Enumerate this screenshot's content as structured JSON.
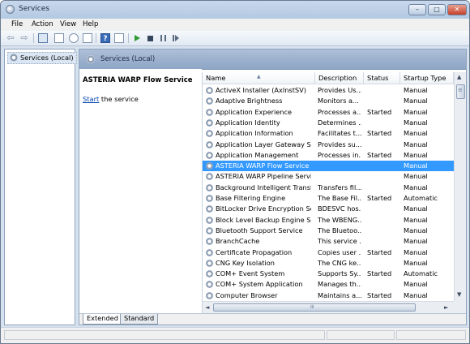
{
  "window": {
    "title": "Services",
    "app_icon": "services-gear-icon"
  },
  "window_controls": {
    "minimize": "–",
    "maximize": "□",
    "close": "✕"
  },
  "menu": [
    "File",
    "Action",
    "View",
    "Help"
  ],
  "toolbar": {
    "icons": [
      "back-arrow-icon",
      "forward-arrow-icon",
      "show-hide-console-tree-icon",
      "properties-icon",
      "refresh-icon",
      "export-list-icon",
      "help-icon",
      "show-hide-action-pane-icon",
      "start-service-icon",
      "stop-service-icon",
      "pause-service-icon",
      "restart-service-icon"
    ],
    "help_glyph": "?"
  },
  "tree": {
    "item": "Services (Local)"
  },
  "pane_header": "Services (Local)",
  "details": {
    "selected_service": "ASTERIA WARP Flow Service",
    "link_text": "Start",
    "link_suffix": " the service"
  },
  "columns": [
    "Name",
    "Description",
    "Status",
    "Startup Type"
  ],
  "rows": [
    {
      "name": "ActiveX Installer (AxInstSV)",
      "description": "Provides Us...",
      "status": "",
      "startup": "Manual"
    },
    {
      "name": "Adaptive Brightness",
      "description": "Monitors a...",
      "status": "",
      "startup": "Manual"
    },
    {
      "name": "Application Experience",
      "description": "Processes a...",
      "status": "Started",
      "startup": "Manual"
    },
    {
      "name": "Application Identity",
      "description": "Determines ...",
      "status": "",
      "startup": "Manual"
    },
    {
      "name": "Application Information",
      "description": "Facilitates t...",
      "status": "Started",
      "startup": "Manual"
    },
    {
      "name": "Application Layer Gateway Ser...",
      "description": "Provides su...",
      "status": "",
      "startup": "Manual"
    },
    {
      "name": "Application Management",
      "description": "Processes in...",
      "status": "Started",
      "startup": "Manual"
    },
    {
      "name": "ASTERIA WARP Flow Service",
      "description": "",
      "status": "",
      "startup": "Manual",
      "selected": true
    },
    {
      "name": "ASTERIA WARP Pipeline Service",
      "description": "",
      "status": "",
      "startup": "Manual"
    },
    {
      "name": "Background Intelligent Transfe...",
      "description": "Transfers fil...",
      "status": "",
      "startup": "Manual"
    },
    {
      "name": "Base Filtering Engine",
      "description": "The Base Fil...",
      "status": "Started",
      "startup": "Automatic"
    },
    {
      "name": "BitLocker Drive Encryption Ser...",
      "description": "BDESVC hos...",
      "status": "",
      "startup": "Manual"
    },
    {
      "name": "Block Level Backup Engine Ser...",
      "description": "The WBENG...",
      "status": "",
      "startup": "Manual"
    },
    {
      "name": "Bluetooth Support Service",
      "description": "The Bluetoo...",
      "status": "",
      "startup": "Manual"
    },
    {
      "name": "BranchCache",
      "description": "This service ...",
      "status": "",
      "startup": "Manual"
    },
    {
      "name": "Certificate Propagation",
      "description": "Copies user ...",
      "status": "Started",
      "startup": "Manual"
    },
    {
      "name": "CNG Key Isolation",
      "description": "The CNG ke...",
      "status": "",
      "startup": "Manual"
    },
    {
      "name": "COM+ Event System",
      "description": "Supports Sy...",
      "status": "Started",
      "startup": "Automatic"
    },
    {
      "name": "COM+ System Application",
      "description": "Manages th...",
      "status": "",
      "startup": "Manual"
    },
    {
      "name": "Computer Browser",
      "description": "Maintains a...",
      "status": "Started",
      "startup": "Manual"
    }
  ],
  "scrollbar": {
    "up": "▲",
    "down": "▼",
    "left": "◄",
    "right": "►",
    "grip": "≡",
    "sort_caret": "▲"
  },
  "tabs": [
    "Extended",
    "Standard"
  ]
}
